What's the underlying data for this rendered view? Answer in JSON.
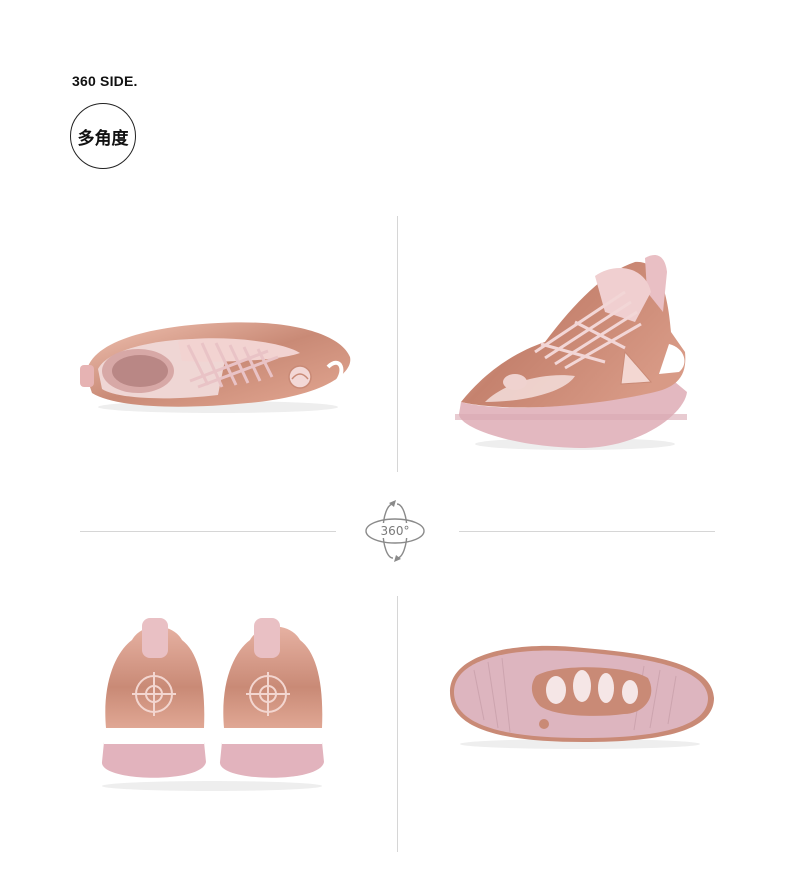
{
  "section": {
    "heading": "360 SIDE.",
    "badge_label": "多角度"
  },
  "rotation_icon": {
    "icon": "rotate-360-icon",
    "label": "360°"
  },
  "photos": [
    {
      "view": "top",
      "name": "shoe-top-view"
    },
    {
      "view": "three-quarter",
      "name": "shoe-three-quarter-view"
    },
    {
      "view": "back",
      "name": "shoe-back-view"
    },
    {
      "view": "sole",
      "name": "shoe-sole-view"
    }
  ],
  "colors": {
    "rose_gold": "#c98a76",
    "rose_gold_light": "#e8b6a6",
    "blush_pink": "#e9c3c6",
    "sole_pink": "#dcb3bd",
    "divider": "#d6d6d6"
  }
}
